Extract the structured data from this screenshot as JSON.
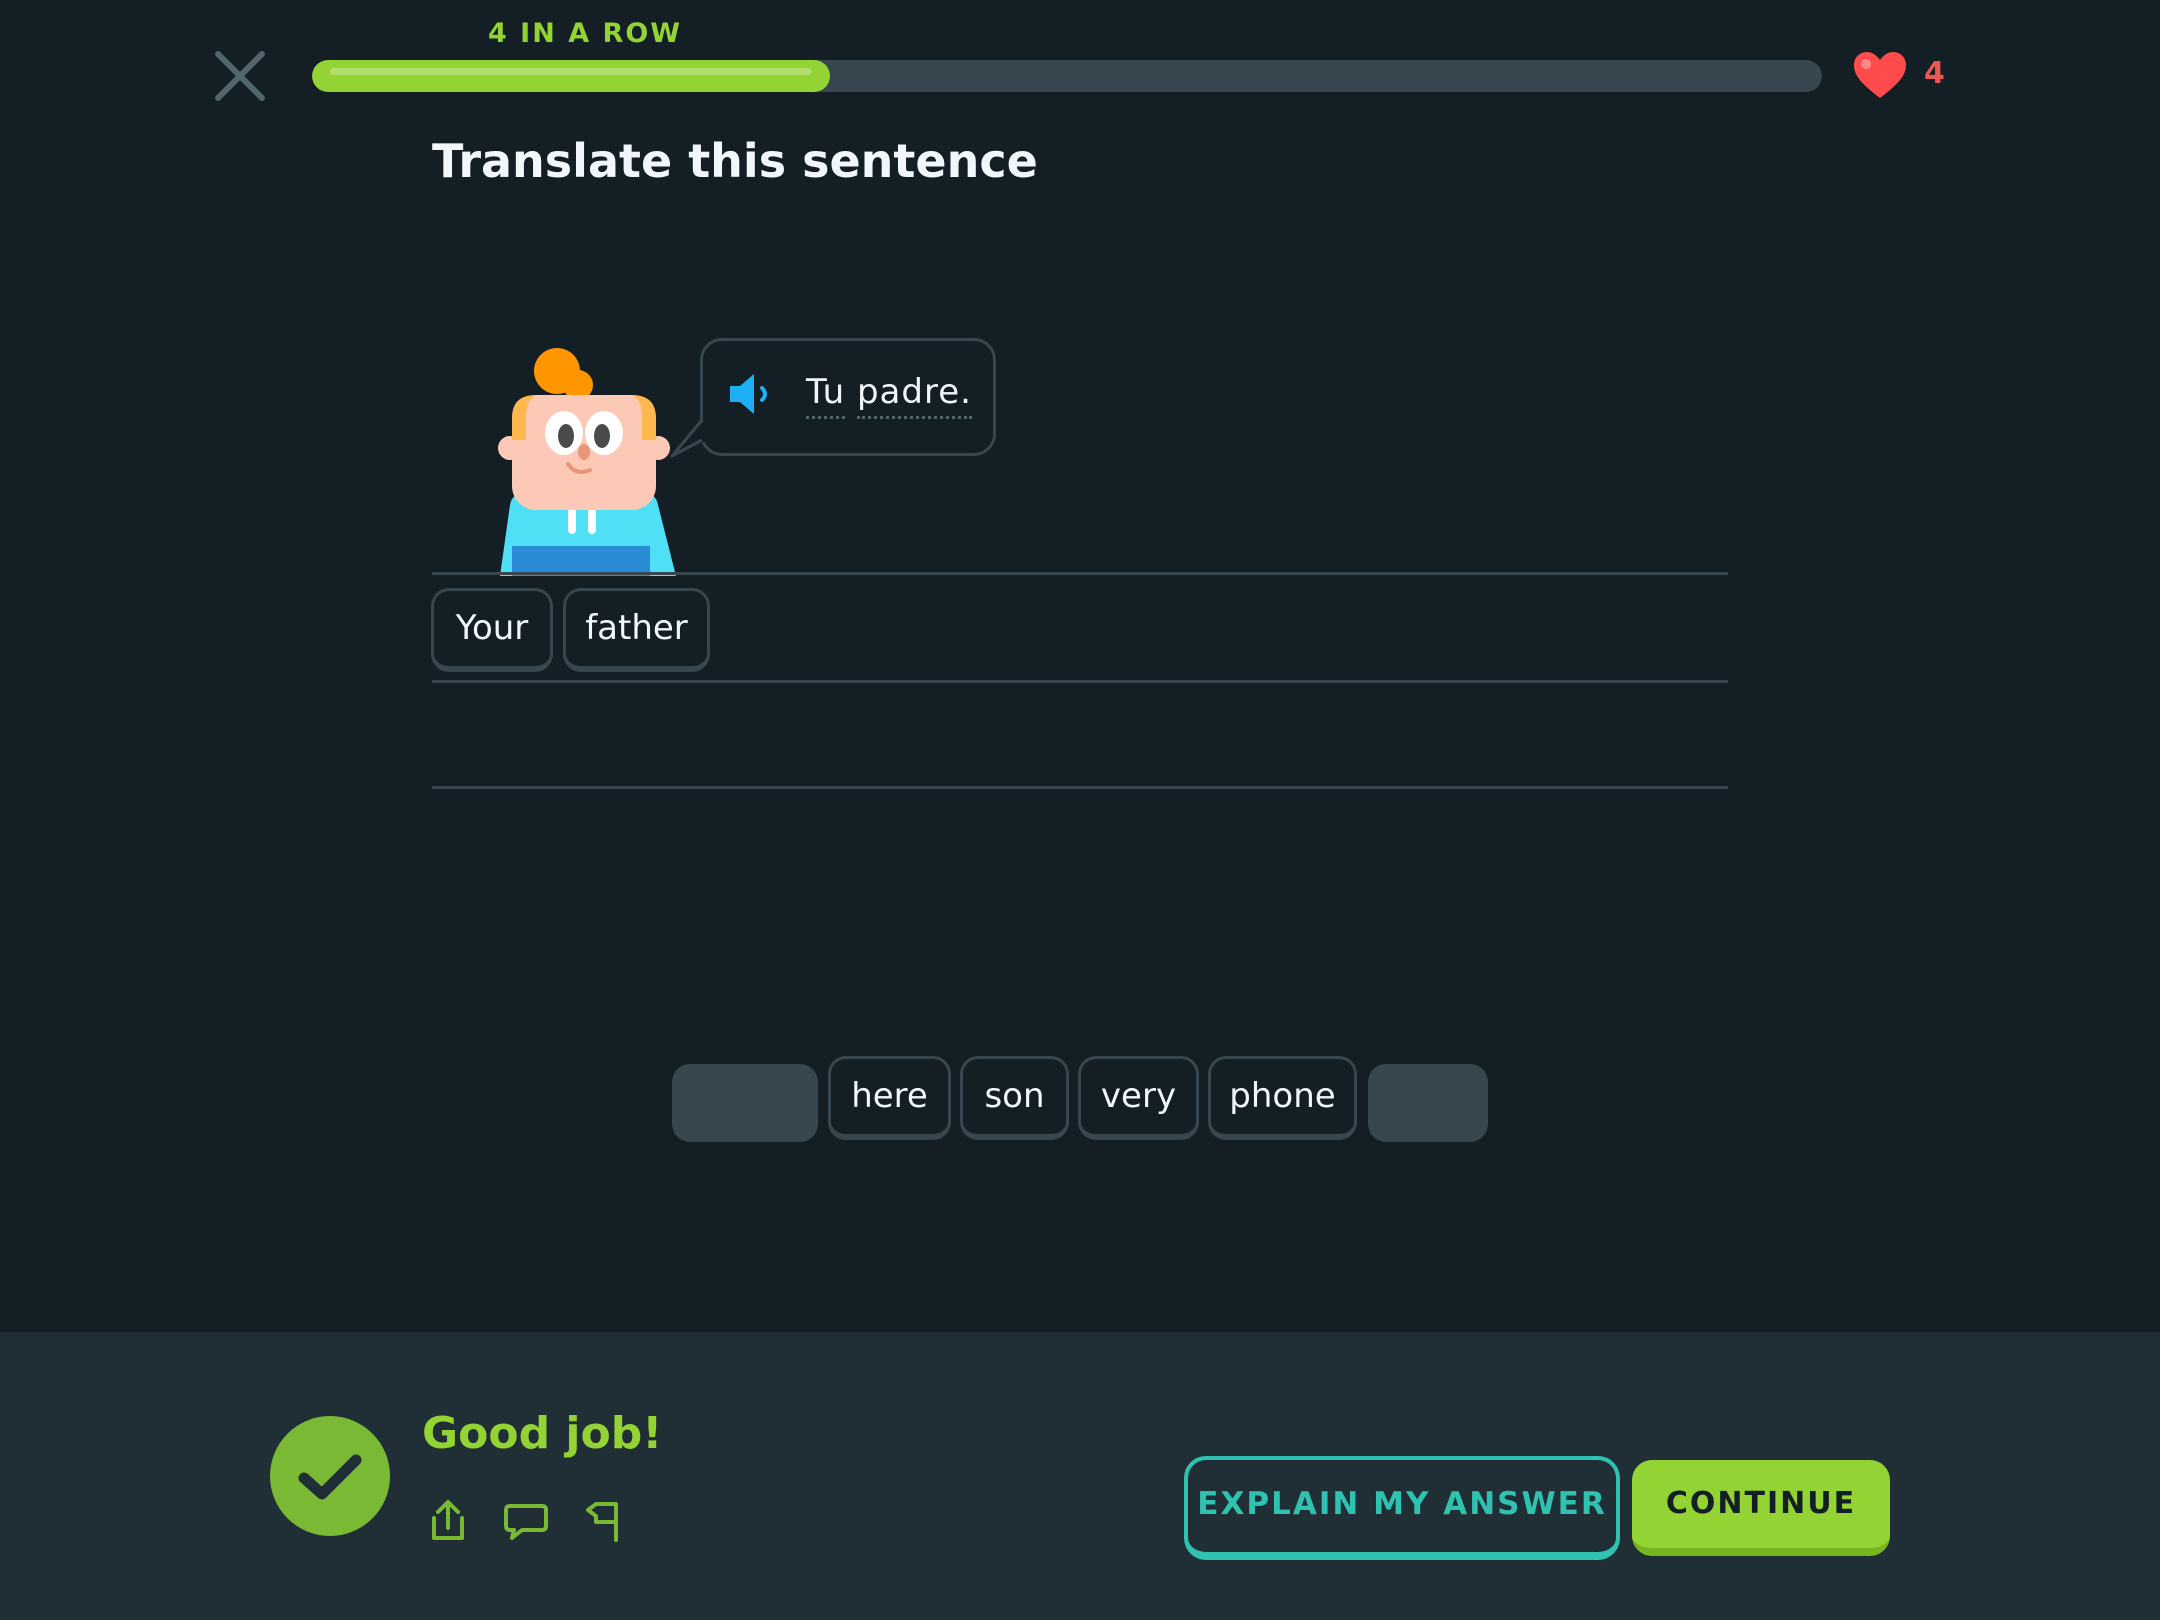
{
  "header": {
    "streak_label": "4 IN A ROW",
    "progress": 0.343,
    "hearts_count": "4",
    "accent_color": "#93d333",
    "heart_color": "#ff4b4b"
  },
  "exercise": {
    "title": "Translate this sentence",
    "prompt_words": [
      "Tu",
      "padre."
    ]
  },
  "answer": {
    "selected_tiles": [
      "Your",
      "father"
    ]
  },
  "word_bank": {
    "tiles": [
      {
        "label": "",
        "used": true
      },
      {
        "label": "here",
        "used": false
      },
      {
        "label": "son",
        "used": false
      },
      {
        "label": "very",
        "used": false
      },
      {
        "label": "phone",
        "used": false
      },
      {
        "label": "",
        "used": true
      }
    ]
  },
  "feedback": {
    "message": "Good job!",
    "explain_label": "EXPLAIN MY ANSWER",
    "continue_label": "CONTINUE",
    "icons": [
      "share-icon",
      "comment-icon",
      "flag-icon"
    ]
  }
}
